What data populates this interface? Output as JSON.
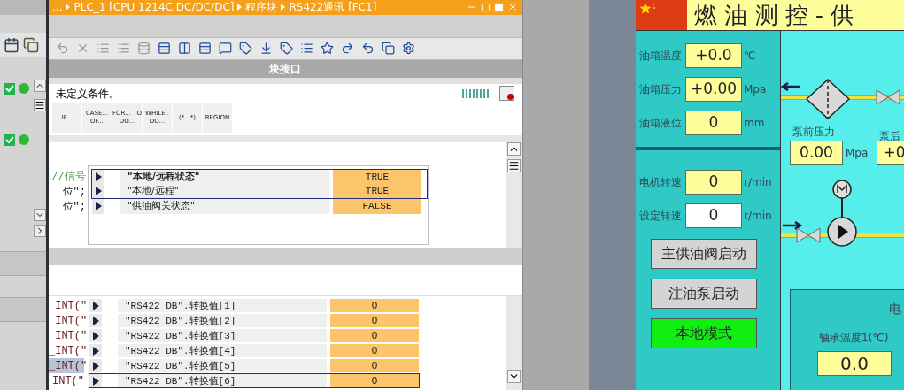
{
  "editor": {
    "breadcrumb": [
      "...",
      "PLC_1 [CPU 1214C DC/DC/DC]",
      "程序块",
      "RS422通讯 [FC1]"
    ],
    "interface_bar": "块接口",
    "hint": "未定义条件。",
    "templates": [
      "IF...",
      "CASE... OF...",
      "FOR... TO DO...",
      "WHILE.. DO...",
      "(*...*)",
      "REGION"
    ],
    "watch_rows": [
      {
        "code": "//信号",
        "name": "\"本地/远程状态\"",
        "value": "TRUE",
        "bold": true,
        "selected": true
      },
      {
        "code": "位\";",
        "name": "\"本地/远程\"",
        "value": "TRUE",
        "bold": false,
        "selected": true
      },
      {
        "code": "位\";",
        "name": "\"供油阀关状态\"",
        "value": "FALSE",
        "bold": false,
        "selected": false
      }
    ],
    "value_rows": [
      {
        "code": "_INT(\"",
        "name": "\"RS422 DB\".转换值[1]",
        "value": "0",
        "highlight": false,
        "selected": false
      },
      {
        "code": "_INT(\"",
        "name": "\"RS422 DB\".转换值[2]",
        "value": "0",
        "highlight": false,
        "selected": false
      },
      {
        "code": "_INT(\"",
        "name": "\"RS422 DB\".转换值[3]",
        "value": "0",
        "highlight": false,
        "selected": false
      },
      {
        "code": "_INT(\"",
        "name": "\"RS422 DB\".转换值[4]",
        "value": "0",
        "highlight": false,
        "selected": false
      },
      {
        "code": "_INT(\"",
        "name": "\"RS422 DB\".转换值[5]",
        "value": "0",
        "highlight": true,
        "selected": false
      },
      {
        "code": "INT(\"",
        "name": "\"RS422 DB\".转换值[6]",
        "value": "0",
        "highlight": false,
        "selected": true
      }
    ]
  },
  "hmi": {
    "title": "燃 油 测 控 - 供",
    "tank": [
      {
        "label": "油箱温度",
        "value": "+0.0",
        "unit": "℃"
      },
      {
        "label": "油箱压力",
        "value": "+0.00",
        "unit": "Mpa"
      },
      {
        "label": "油箱液位",
        "value": "0",
        "unit": "mm"
      }
    ],
    "motor": [
      {
        "label": "电机转速",
        "value": "0",
        "unit": "r/min",
        "kind": "display"
      },
      {
        "label": "设定转速",
        "value": "0",
        "unit": "r/min",
        "kind": "input"
      }
    ],
    "buttons": [
      {
        "label": "主供油阀启动",
        "active": false
      },
      {
        "label": "注油泵启动",
        "active": false
      },
      {
        "label": "本地模式",
        "active": true
      }
    ],
    "pre_pump": {
      "label": "泵前压力",
      "value": "0.00",
      "unit": "Mpa"
    },
    "post_pump": {
      "label": "泵后",
      "value": "+0"
    },
    "bearing_panel": {
      "title": "电",
      "label": "轴承温度1(℃)",
      "value": "0.0"
    }
  }
}
